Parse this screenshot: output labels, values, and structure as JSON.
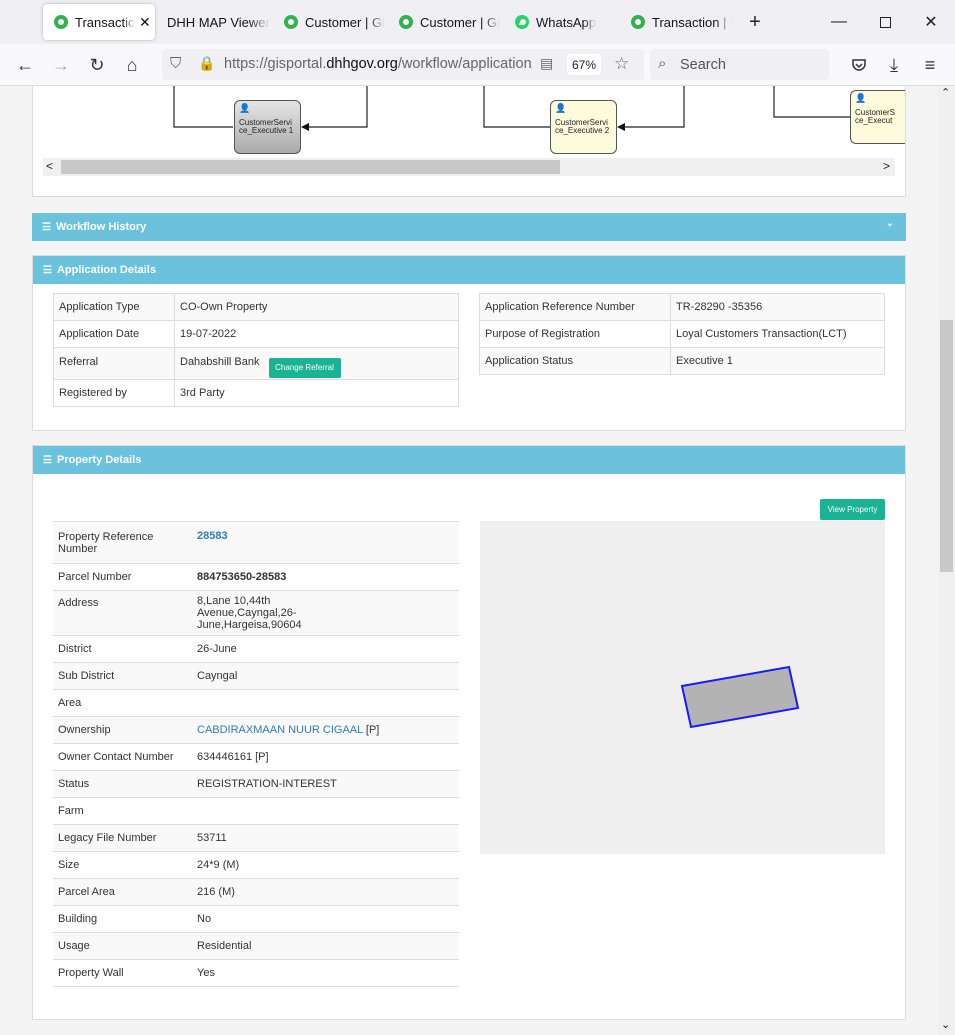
{
  "browser": {
    "tabs": [
      {
        "label": "Transaction",
        "icon": "green-logo-icon"
      },
      {
        "label": "DHH MAP Viewer",
        "icon": ""
      },
      {
        "label": "Customer | GI",
        "icon": "green-logo-icon"
      },
      {
        "label": "Customer | GI",
        "icon": "green-logo-icon"
      },
      {
        "label": "WhatsApp",
        "icon": "whatsapp-icon"
      },
      {
        "label": "Transaction | C",
        "icon": "green-logo-icon"
      }
    ],
    "url_prefix": "https://gisportal.",
    "url_domain": "dhhgov.org",
    "url_suffix": "/workflow/application/",
    "zoom": "67%",
    "search_placeholder": "Search",
    "accent_color": "#6ac2dd"
  },
  "workflow": {
    "nodes": [
      {
        "label": "CustomerServi ce_Executive 1",
        "state": "active"
      },
      {
        "label": "CustomerServi ce_Executive 2",
        "state": "pending"
      },
      {
        "label": "CustomerS ce_Execut",
        "state": "pending"
      }
    ]
  },
  "workflow_history": {
    "title": "Workflow History"
  },
  "application_details": {
    "title": "Application Details",
    "left": [
      {
        "label": "Application Type",
        "value": "CO-Own Property"
      },
      {
        "label": "Application Date",
        "value": "19-07-2022"
      },
      {
        "label": "Referral",
        "value": "Dahabshill Bank"
      },
      {
        "label": "Registered by",
        "value": "3rd Party"
      }
    ],
    "change_referral_label": "Change Referral",
    "right": [
      {
        "label": "Application Reference Number",
        "value": "TR-28290 -35356"
      },
      {
        "label": "Purpose of Registration",
        "value": "Loyal Customers Transaction(LCT)"
      },
      {
        "label": "Application Status",
        "value": "Executive 1"
      }
    ]
  },
  "property_details": {
    "title": "Property Details",
    "view_property_label": "View Property",
    "rows": [
      {
        "label": "Property Reference Number",
        "value": "28583"
      },
      {
        "label": "Parcel Number",
        "value": "884753650-28583"
      },
      {
        "label": "Address",
        "value": "8,Lane 10,44th Avenue,Cayngal,26-June,Hargeisa,90604"
      },
      {
        "label": "District",
        "value": "26-June"
      },
      {
        "label": "Sub District",
        "value": "Cayngal"
      },
      {
        "label": "Area",
        "value": ""
      },
      {
        "label": "Ownership",
        "value": "CABDIRAXMAAN NUUR CIGAAL",
        "suffix": "[P]"
      },
      {
        "label": "Owner Contact Number",
        "value": "634446161 [P]"
      },
      {
        "label": "Status",
        "value": "REGISTRATION-INTEREST"
      },
      {
        "label": "Farm",
        "value": ""
      },
      {
        "label": "Legacy File Number",
        "value": "53711"
      },
      {
        "label": "Size",
        "value": "24*9 (M)"
      },
      {
        "label": "Parcel Area",
        "value": "216 (M)"
      },
      {
        "label": "Building",
        "value": "No"
      },
      {
        "label": "Usage",
        "value": "Residential"
      },
      {
        "label": "Property Wall",
        "value": "Yes"
      }
    ]
  }
}
